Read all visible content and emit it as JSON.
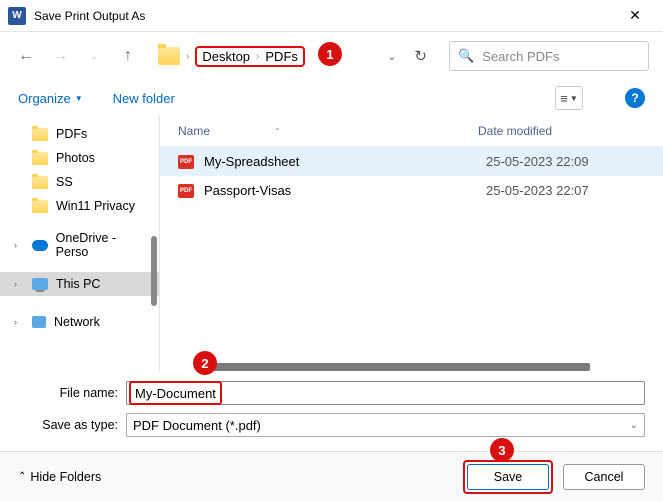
{
  "window": {
    "title": "Save Print Output As"
  },
  "breadcrumb": {
    "p1": "Desktop",
    "p2": "PDFs"
  },
  "search": {
    "placeholder": "Search PDFs"
  },
  "toolbar": {
    "organize": "Organize",
    "newfolder": "New folder"
  },
  "sidebar": {
    "items": [
      "PDFs",
      "Photos",
      "SS",
      "Win11 Privacy"
    ],
    "onedrive": "OneDrive - Perso",
    "thispc": "This PC",
    "network": "Network"
  },
  "columns": {
    "name": "Name",
    "date": "Date modified"
  },
  "files": [
    {
      "name": "My-Spreadsheet",
      "date": "25-05-2023 22:09"
    },
    {
      "name": "Passport-Visas",
      "date": "25-05-2023 22:07"
    }
  ],
  "form": {
    "filename_label": "File name:",
    "filename_value": "My-Document",
    "type_label": "Save as type:",
    "type_value": "PDF Document (*.pdf)"
  },
  "footer": {
    "hide": "Hide Folders",
    "save": "Save",
    "cancel": "Cancel"
  },
  "badges": {
    "b1": "1",
    "b2": "2",
    "b3": "3"
  }
}
